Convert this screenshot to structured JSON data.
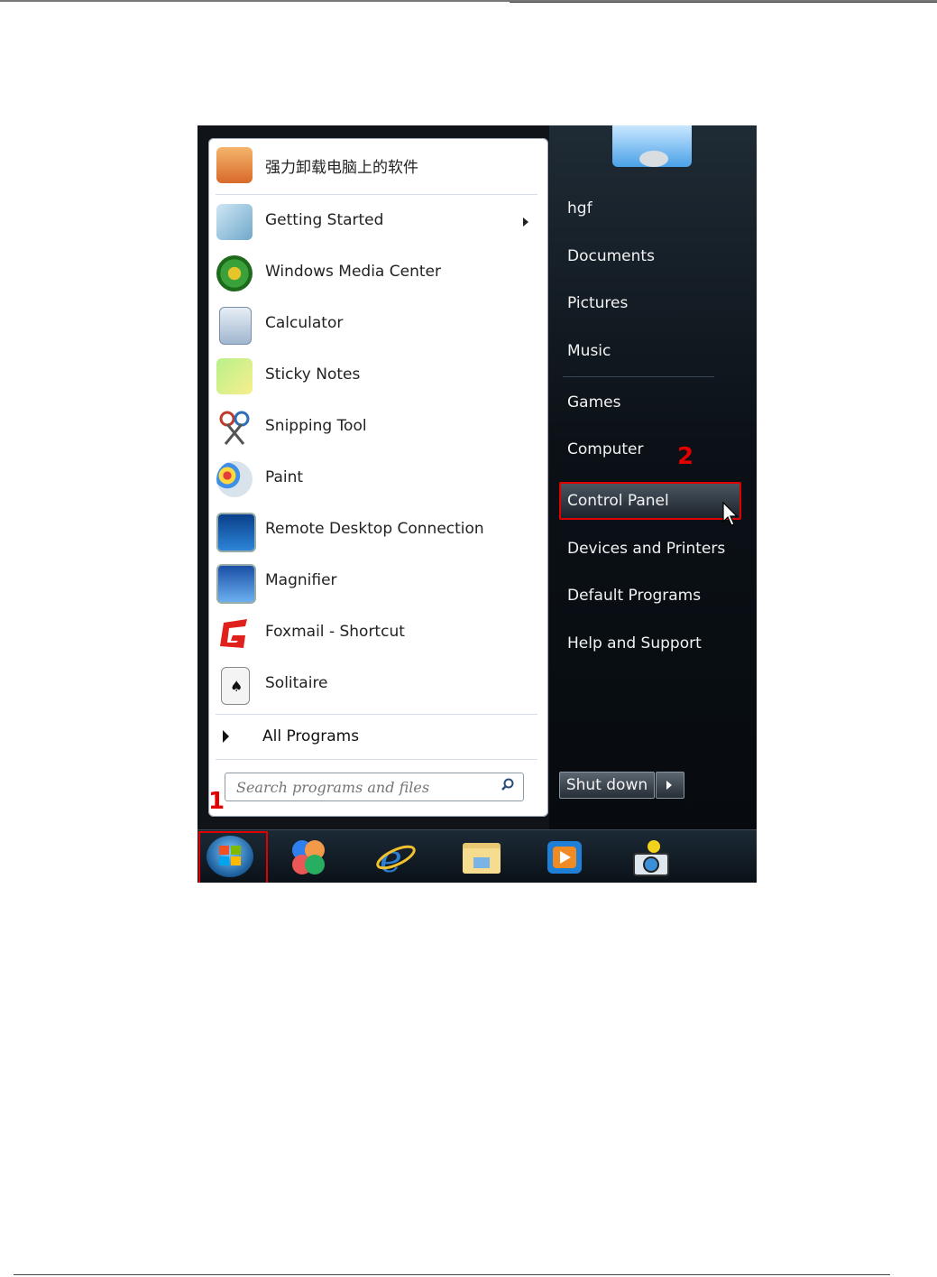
{
  "start_menu": {
    "pinned": {
      "label": "强力卸载电脑上的软件",
      "icon": "uninstall-box-icon"
    },
    "programs": [
      {
        "label": "Getting Started",
        "icon": "getting-started-icon",
        "has_submenu": true
      },
      {
        "label": "Windows Media Center",
        "icon": "windows-media-center-icon"
      },
      {
        "label": "Calculator",
        "icon": "calculator-icon"
      },
      {
        "label": "Sticky Notes",
        "icon": "sticky-notes-icon"
      },
      {
        "label": "Snipping Tool",
        "icon": "snipping-tool-icon"
      },
      {
        "label": "Paint",
        "icon": "paint-icon"
      },
      {
        "label": "Remote Desktop Connection",
        "icon": "remote-desktop-icon"
      },
      {
        "label": "Magnifier",
        "icon": "magnifier-icon"
      },
      {
        "label": "Foxmail - Shortcut",
        "icon": "foxmail-icon"
      },
      {
        "label": "Solitaire",
        "icon": "solitaire-icon"
      }
    ],
    "all_programs_label": "All Programs",
    "search_placeholder": "Search programs and files",
    "right_links": {
      "user": "hgf",
      "documents": "Documents",
      "pictures": "Pictures",
      "music": "Music",
      "games": "Games",
      "computer": "Computer",
      "control_panel": "Control Panel",
      "devices": "Devices and Printers",
      "default_programs": "Default Programs",
      "help": "Help and Support"
    },
    "shutdown_label": "Shut down"
  },
  "annotations": {
    "step1": "1",
    "step2": "2",
    "color": "#e00000"
  },
  "taskbar": {
    "icons": [
      "start-orb-icon",
      "pinwheel-app-icon",
      "internet-explorer-icon",
      "file-explorer-icon",
      "media-player-icon",
      "camera-app-icon"
    ]
  }
}
